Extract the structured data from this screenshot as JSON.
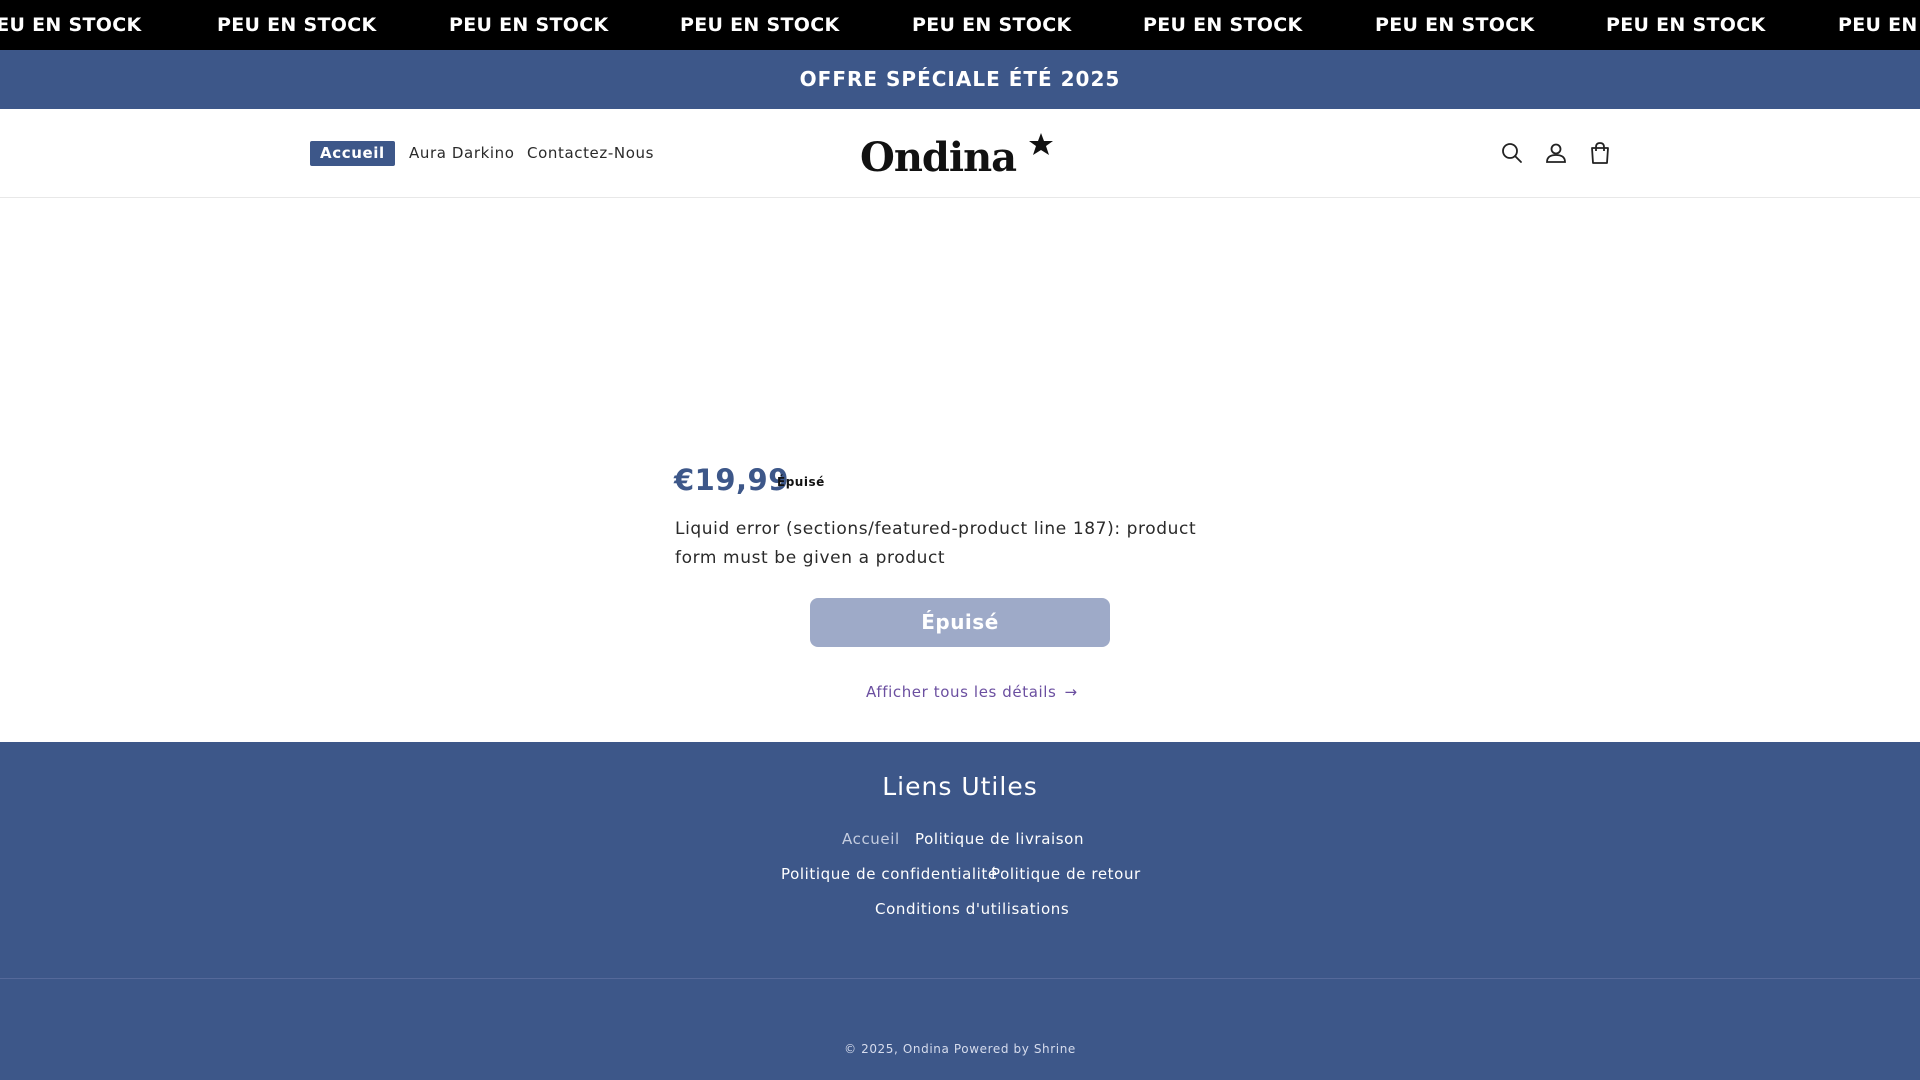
{
  "marquee": {
    "items": [
      "PEU EN STOCK",
      "PEU EN STOCK",
      "PEU EN STOCK",
      "PEU EN STOCK",
      "PEU EN STOCK",
      "PEU EN STOCK",
      "PEU EN STOCK",
      "PEU EN STOCK",
      "PEU EN STOCK"
    ]
  },
  "promo": {
    "text": "OFFRE SPÉCIALE ÉTÉ 2025"
  },
  "header": {
    "nav": [
      "Accueil",
      "Aura Darkino",
      "Contactez-Nous"
    ],
    "logo_text": "Ondina",
    "icons": [
      "search-icon",
      "account-icon",
      "cart-icon"
    ]
  },
  "product": {
    "price": "€19,99",
    "sold_out_tag": "Épuisé",
    "error": "Liquid error (sections/featured-product line 187): product form must be given a product",
    "button": "Épuisé",
    "details_link": "Afficher tous les détails",
    "details_arrow": "→"
  },
  "footer": {
    "title": "Liens Utiles",
    "links": [
      "Accueil",
      "Politique de livraison",
      "Politique de confidentialité",
      "Politique de retour",
      "Conditions d'utilisations"
    ],
    "copyright_prefix": "© 2025, ",
    "copyright_brand": "Ondina",
    "powered_by": "Powered by Shrine"
  },
  "colors": {
    "brand_blue": "#3d5789",
    "marquee_bg": "#000000",
    "disabled_button": "#9eaac8",
    "link_purple": "#6b4fa0"
  }
}
